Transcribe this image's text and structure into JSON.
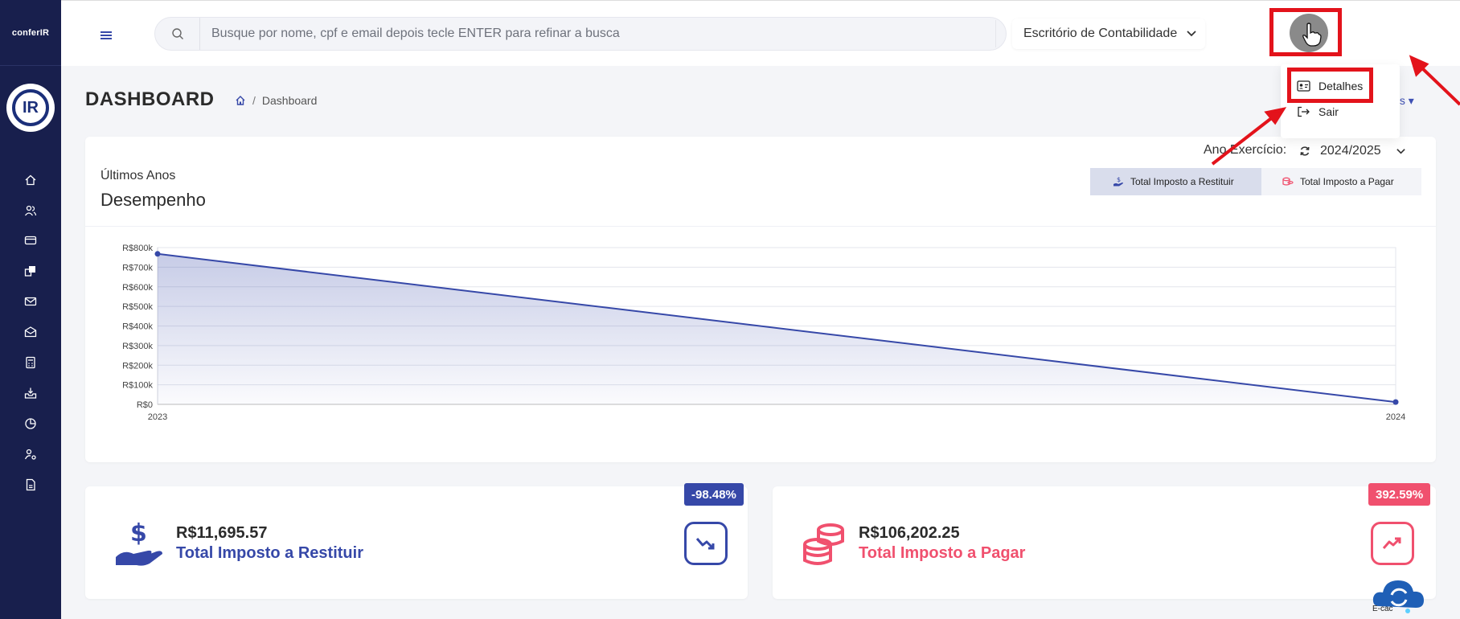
{
  "sidebar": {
    "logo_text": "conferIR",
    "brand_text": "IR",
    "items": [
      {
        "icon": "home-icon"
      },
      {
        "icon": "users-icon"
      },
      {
        "icon": "card-icon"
      },
      {
        "icon": "documents-icon"
      },
      {
        "icon": "mail-icon"
      },
      {
        "icon": "mail-open-icon"
      },
      {
        "icon": "calculator-icon"
      },
      {
        "icon": "inbox-download-icon"
      },
      {
        "icon": "pie-chart-icon"
      },
      {
        "icon": "user-settings-icon"
      },
      {
        "icon": "file-icon"
      }
    ]
  },
  "topbar": {
    "search_placeholder": "Busque por nome, cpf e email depois tecle ENTER para refinar a busca",
    "office_select": "Escritório de Contabilidade Co"
  },
  "user_menu": {
    "items": [
      {
        "label": "Detalhes",
        "icon": "id-card-icon"
      },
      {
        "label": "Sair",
        "icon": "logout-icon"
      }
    ]
  },
  "header": {
    "title": "DASHBOARD",
    "breadcrumb_sep": "/",
    "breadcrumb_current": "Dashboard",
    "more_link": "ais"
  },
  "chart_card": {
    "subtitle": "Últimos Anos",
    "title": "Desempenho",
    "year_label": "Ano Exercício:",
    "year_value": "2024/2025",
    "tabs": [
      {
        "label": "Total Imposto a Restituir",
        "active": true
      },
      {
        "label": "Total Imposto a Pagar",
        "active": false
      }
    ]
  },
  "chart_data": {
    "type": "area",
    "x": [
      "2023",
      "2024"
    ],
    "series": [
      {
        "values": [
          768000,
          11695.57
        ]
      }
    ],
    "ylim": [
      0,
      800000
    ],
    "yticks": [
      "R$0",
      "R$100k",
      "R$200k",
      "R$300k",
      "R$400k",
      "R$500k",
      "R$600k",
      "R$700k",
      "R$800k"
    ],
    "grid": true,
    "color": "#3648a8"
  },
  "kpis": {
    "restituir": {
      "value": "R$11,695.57",
      "label": "Total Imposto a Restituir",
      "badge": "-98.48%",
      "color": "#3648a8"
    },
    "pagar": {
      "value": "R$106,202.25",
      "label": "Total Imposto a Pagar",
      "badge": "392.59%",
      "color": "#f0506e"
    }
  },
  "ecac": {
    "label": "E-cac"
  }
}
